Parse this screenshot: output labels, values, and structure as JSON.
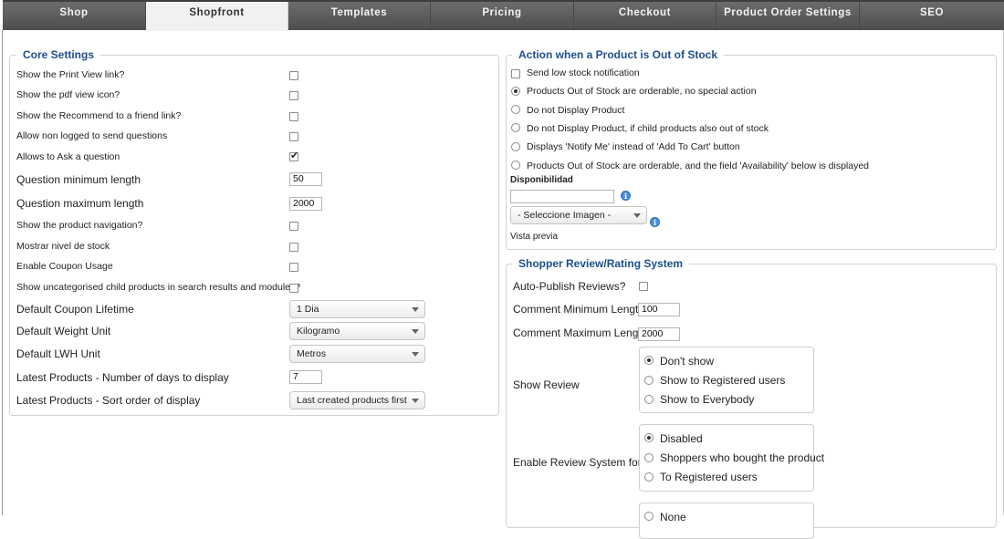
{
  "tabs": [
    "Shop",
    "Shopfront",
    "Templates",
    "Pricing",
    "Checkout",
    "Product Order Settings",
    "SEO"
  ],
  "active_tab": "Shopfront",
  "core": {
    "legend": "Core Settings",
    "print_view": "Show the Print View link?",
    "pdf_icon": "Show the pdf view icon?",
    "recommend": "Show the Recommend to a friend link?",
    "non_logged": "Allow non logged to send questions",
    "ask_question": "Allows to Ask a question",
    "q_min": "Question minimum length",
    "q_min_value": "50",
    "q_max": "Question maximum length",
    "q_max_value": "2000",
    "product_nav": "Show the product navigation?",
    "stock_level": "Mostrar nivel de stock",
    "coupon_usage": "Enable Coupon Usage",
    "uncategorised": "Show uncategorised child products in search results and modules?",
    "coupon_lifetime": "Default Coupon Lifetime",
    "coupon_lifetime_value": "1 Dia",
    "weight_unit": "Default Weight Unit",
    "weight_unit_value": "Kilogramo",
    "lwh_unit": "Default LWH Unit",
    "lwh_unit_value": "Metros",
    "latest_days": "Latest Products - Number of days to display",
    "latest_days_value": "7",
    "latest_sort": "Latest Products - Sort order of display",
    "latest_sort_value": "Last created products first"
  },
  "stock": {
    "legend": "Action when a Product is Out of Stock",
    "low_stock": "Send low stock notification",
    "opt1": "Products Out of Stock are orderable, no special action",
    "opt2": "Do not Display Product",
    "opt3": "Do not Display Product, if child products also out of stock",
    "opt4": "Displays 'Notify Me' instead of 'Add To Cart' button",
    "opt5": "Products Out of Stock are orderable, and the field 'Availability' below is displayed",
    "disponibilidad": "Disponibilidad",
    "image_select": "- Seleccione Imagen -",
    "preview": "Vista previa",
    "info_icon": "info-icon"
  },
  "review": {
    "legend": "Shopper Review/Rating System",
    "auto_publish": "Auto-Publish Reviews?",
    "comment_min": "Comment Minimum Length",
    "comment_min_value": "100",
    "comment_max": "Comment Maximum Length",
    "comment_max_value": "2000",
    "show_review": "Show Review",
    "show_opts": [
      "Don't show",
      "Show to Registered users",
      "Show to Everybody"
    ],
    "enable_for": "Enable Review System for",
    "enable_opts": [
      "Disabled",
      "Shoppers who bought the product",
      "To Registered users"
    ],
    "partial_opt": "None"
  },
  "colors": {
    "legend": "#1d4f8a",
    "tabbar": "#5a5a5a",
    "active_tab": "#f1f1f1"
  }
}
